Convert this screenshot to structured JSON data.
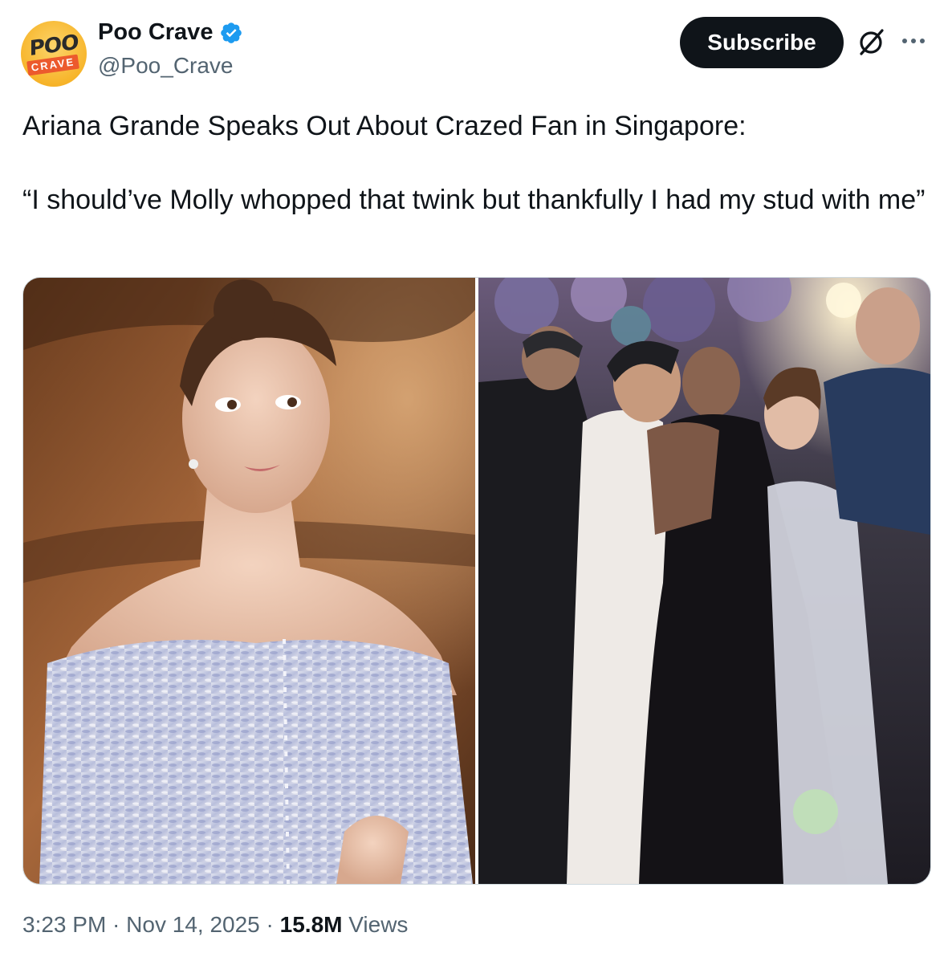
{
  "author": {
    "display_name": "Poo Crave",
    "handle": "@Poo_Crave",
    "avatar_text_top": "POO",
    "avatar_text_bottom": "CRAVE",
    "verified_icon": "verified-badge-icon",
    "verified_color": "#1d9bf0"
  },
  "actions": {
    "subscribe_label": "Subscribe",
    "grok_icon": "grok-icon",
    "more_icon": "more-icon"
  },
  "tweet": {
    "text": "Ariana Grande Speaks Out About Crazed Fan in Singapore:\n\n“I should’ve Molly whopped that twink but thankfully I had my stud with me”"
  },
  "media": {
    "count": 2
  },
  "meta": {
    "time": "3:23 PM",
    "separator": " · ",
    "date": "Nov 14, 2025",
    "views_count": "15.8M",
    "views_label": " Views"
  },
  "colors": {
    "primary_text": "#0f1419",
    "secondary_text": "#536471",
    "button_bg": "#0f1419",
    "verified": "#1d9bf0"
  }
}
